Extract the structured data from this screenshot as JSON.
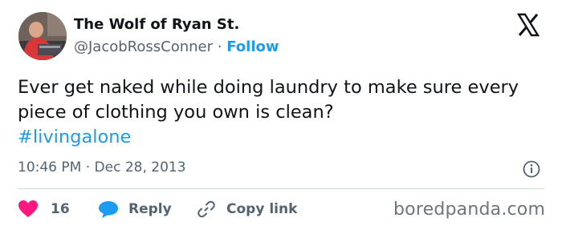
{
  "author": {
    "display_name": "The Wolf of Ryan St.",
    "handle": "@JacobRossConner",
    "separator": "·",
    "follow_label": "Follow"
  },
  "tweet": {
    "text": "Ever get naked while doing laundry to make sure every piece of clothing you own is clean?",
    "hashtag": "#livingalone",
    "time": "10:46 PM",
    "date_separator": "·",
    "date": "Dec 28, 2013"
  },
  "actions": {
    "like_count": "16",
    "reply_label": "Reply",
    "copy_link_label": "Copy link"
  },
  "watermark": "boredpanda.com",
  "colors": {
    "accent": "#1d9bf0",
    "like": "#f91880",
    "text": "#0f1419",
    "muted": "#536471"
  },
  "icons": {
    "platform": "x-logo-icon",
    "info": "info-icon",
    "like": "heart-icon",
    "reply": "speech-bubble-icon",
    "copy_link": "link-icon"
  }
}
